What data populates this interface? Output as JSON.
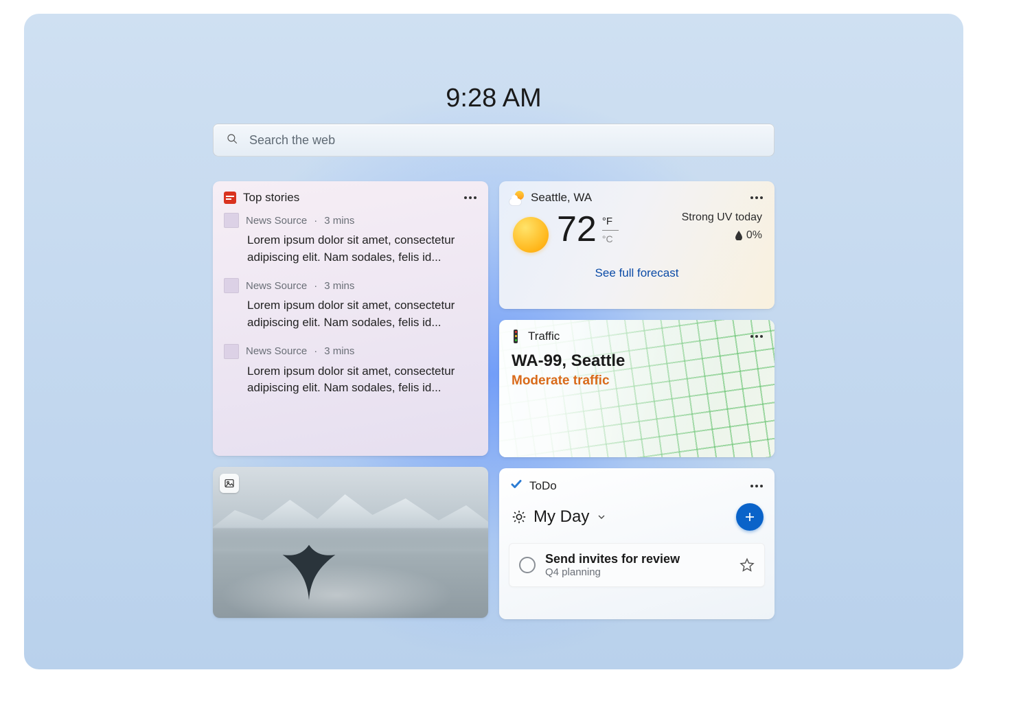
{
  "clock": "9:28 AM",
  "search": {
    "placeholder": "Search the web"
  },
  "news": {
    "title": "Top stories",
    "items": [
      {
        "source": "News Source",
        "age": "3 mins",
        "headline": "Lorem ipsum dolor sit amet, consectetur adipiscing elit. Nam sodales, felis id..."
      },
      {
        "source": "News Source",
        "age": "3 mins",
        "headline": "Lorem ipsum dolor sit amet, consectetur adipiscing elit. Nam sodales, felis id..."
      },
      {
        "source": "News Source",
        "age": "3 mins",
        "headline": "Lorem ipsum dolor sit amet, consectetur adipiscing elit. Nam sodales, felis id..."
      }
    ]
  },
  "weather": {
    "location": "Seattle, WA",
    "temp": "72",
    "unit_f": "°F",
    "unit_c": "°C",
    "condition": "Strong UV today",
    "precip": "0%",
    "forecast_link": "See full forecast"
  },
  "traffic": {
    "title": "Traffic",
    "route": "WA-99, Seattle",
    "status": "Moderate traffic"
  },
  "todo": {
    "title": "ToDo",
    "list_name": "My Day",
    "tasks": [
      {
        "name": "Send invites for review",
        "subtitle": "Q4 planning"
      }
    ]
  }
}
